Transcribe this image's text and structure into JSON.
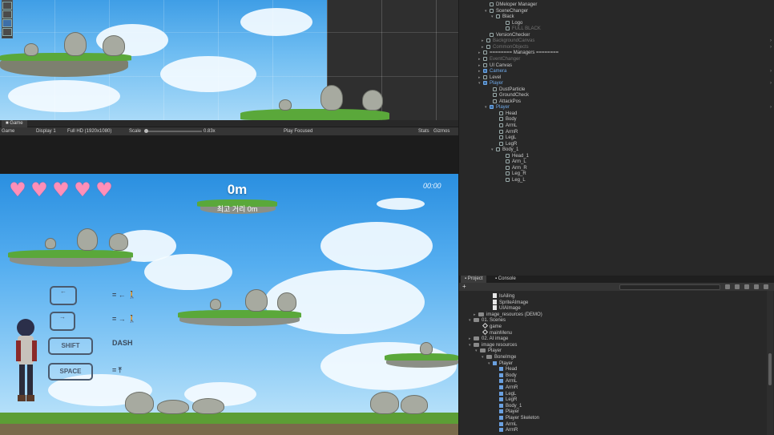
{
  "game_tab": {
    "label": "Game"
  },
  "game_toolbar": {
    "mode": "Game",
    "display": "Display 1",
    "resolution": "Full HD (1920x1080)",
    "scale_label": "Scale",
    "scale_value": "0.83x",
    "play_focused": "Play Focused",
    "stats": "Stats",
    "gizmos": "Gizmos"
  },
  "hud": {
    "hearts": 5,
    "heart_glyph": "♥",
    "distance": "0m",
    "best_distance": "최고 거리 0m",
    "timer": "00:00"
  },
  "controls_help": {
    "shift_key": "SHIFT",
    "space_key": "SPACE",
    "dash_text": "DASH"
  },
  "hierarchy": {
    "rows": [
      {
        "label": "DMeloper Manager",
        "indent": 32,
        "type": "go"
      },
      {
        "label": "SceneChanger",
        "indent": 32,
        "type": "go",
        "arrow": "▾"
      },
      {
        "label": "Black",
        "indent": 40,
        "type": "go",
        "arrow": "▾"
      },
      {
        "label": "Logo",
        "indent": 52,
        "type": "go"
      },
      {
        "label": "FULL BLACK",
        "indent": 52,
        "type": "disabled"
      },
      {
        "label": "VersionChecker",
        "indent": 32,
        "type": "go"
      },
      {
        "label": "BackgroundCanvas",
        "indent": 28,
        "type": "prefab-disabled",
        "arrow": "▸"
      },
      {
        "label": "CommonObjects",
        "indent": 28,
        "type": "prefab-disabled",
        "arrow": "▸"
      },
      {
        "label": "======== Managers ========",
        "indent": 24,
        "type": "go",
        "arrow": "▸"
      },
      {
        "label": "EventChanger",
        "indent": 24,
        "type": "disabled",
        "arrow": "▸"
      },
      {
        "label": "UI Canvas",
        "indent": 24,
        "type": "go",
        "arrow": "▸"
      },
      {
        "label": "Camera",
        "indent": 24,
        "type": "prefab",
        "arrow": "▸"
      },
      {
        "label": "Level",
        "indent": 24,
        "type": "go",
        "arrow": "▸"
      },
      {
        "label": "Player",
        "indent": 24,
        "type": "prefab",
        "arrow": "▾"
      },
      {
        "label": "DustParticle",
        "indent": 36,
        "type": "go"
      },
      {
        "label": "GroundCheck",
        "indent": 36,
        "type": "go"
      },
      {
        "label": "AttackPos",
        "indent": 36,
        "type": "go"
      },
      {
        "label": "Player",
        "indent": 32,
        "type": "prefab",
        "arrow": "▾"
      },
      {
        "label": "Head",
        "indent": 44,
        "type": "go"
      },
      {
        "label": "Body",
        "indent": 44,
        "type": "go"
      },
      {
        "label": "ArmL",
        "indent": 44,
        "type": "go"
      },
      {
        "label": "ArmR",
        "indent": 44,
        "type": "go"
      },
      {
        "label": "LegL",
        "indent": 44,
        "type": "go"
      },
      {
        "label": "LegR",
        "indent": 44,
        "type": "go"
      },
      {
        "label": "Body_1",
        "indent": 40,
        "type": "go",
        "arrow": "▾"
      },
      {
        "label": "Head_1",
        "indent": 52,
        "type": "go"
      },
      {
        "label": "Arm_L",
        "indent": 52,
        "type": "go"
      },
      {
        "label": "Arm_R",
        "indent": 52,
        "type": "go"
      },
      {
        "label": "Leg_R",
        "indent": 52,
        "type": "go"
      },
      {
        "label": "Leg_L",
        "indent": 52,
        "type": "go"
      }
    ]
  },
  "project": {
    "tabs": [
      "Project",
      "Console"
    ],
    "add_label": "+",
    "rows": [
      {
        "label": "IsAiling",
        "indent": 36,
        "icon": "script"
      },
      {
        "label": "SpriteAImage",
        "indent": 36,
        "icon": "script"
      },
      {
        "label": "UIAImage",
        "indent": 36,
        "icon": "script"
      },
      {
        "label": "image_resources (DEMO)",
        "indent": 18,
        "icon": "folder",
        "arrow": "▸"
      },
      {
        "label": "01. Scenes",
        "indent": 12,
        "icon": "folder",
        "arrow": "▾"
      },
      {
        "label": "game",
        "indent": 24,
        "icon": "unity"
      },
      {
        "label": "mainMenu",
        "indent": 24,
        "icon": "unity"
      },
      {
        "label": "02. AI image",
        "indent": 12,
        "icon": "folder",
        "arrow": "▸"
      },
      {
        "label": "image resources",
        "indent": 12,
        "icon": "folder",
        "arrow": "▾"
      },
      {
        "label": "Player",
        "indent": 20,
        "icon": "folder",
        "arrow": "▾"
      },
      {
        "label": "BoneImge",
        "indent": 28,
        "icon": "folder",
        "arrow": "▾"
      },
      {
        "label": "Player",
        "indent": 36,
        "icon": "sprite",
        "arrow": "▾"
      },
      {
        "label": "Head",
        "indent": 44,
        "icon": "sprite"
      },
      {
        "label": "Body",
        "indent": 44,
        "icon": "sprite"
      },
      {
        "label": "ArmL",
        "indent": 44,
        "icon": "sprite"
      },
      {
        "label": "ArmR",
        "indent": 44,
        "icon": "sprite"
      },
      {
        "label": "LegL",
        "indent": 44,
        "icon": "sprite"
      },
      {
        "label": "LegR",
        "indent": 44,
        "icon": "sprite"
      },
      {
        "label": "Body_1",
        "indent": 44,
        "icon": "sprite"
      },
      {
        "label": "Player",
        "indent": 44,
        "icon": "sprite"
      },
      {
        "label": "Player Skeleton",
        "indent": 44,
        "icon": "sprite"
      },
      {
        "label": "ArmL",
        "indent": 44,
        "icon": "sprite"
      },
      {
        "label": "ArmR",
        "indent": 44,
        "icon": "sprite"
      }
    ]
  },
  "colors": {
    "accent": "#3d6fa8",
    "prefab": "#6fa8e8",
    "heart": "#ff8fb8",
    "grass": "#5aa83a"
  }
}
